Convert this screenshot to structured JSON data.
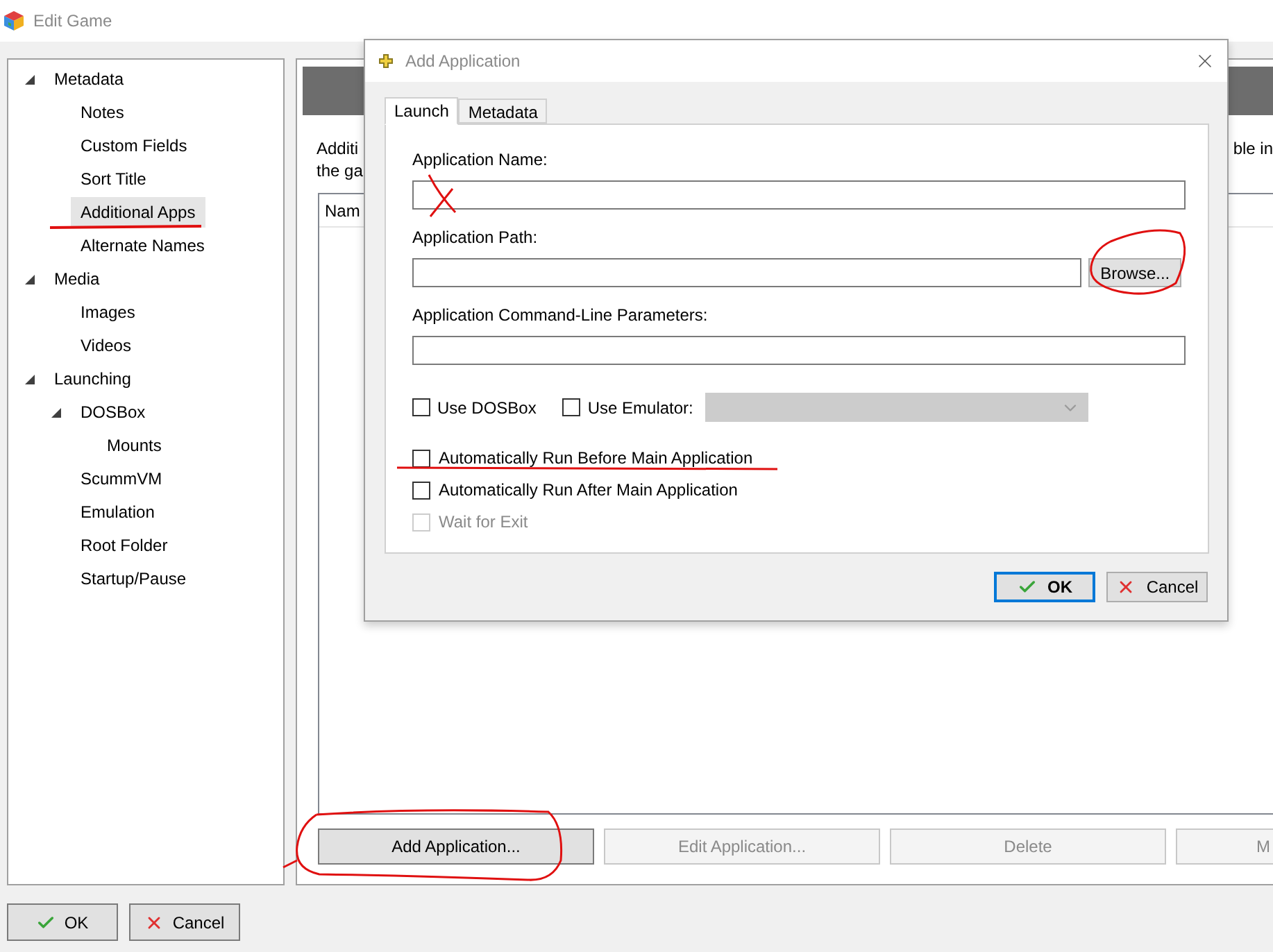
{
  "window": {
    "title": "Edit Game"
  },
  "tree": [
    {
      "label": "Metadata",
      "selected": false,
      "expanded": true,
      "children": [
        {
          "label": "Notes",
          "selected": false
        },
        {
          "label": "Custom Fields",
          "selected": false
        },
        {
          "label": "Sort Title",
          "selected": false
        },
        {
          "label": "Additional Apps",
          "selected": true
        },
        {
          "label": "Alternate Names",
          "selected": false
        }
      ]
    },
    {
      "label": "Media",
      "selected": false,
      "expanded": true,
      "children": [
        {
          "label": "Images",
          "selected": false
        },
        {
          "label": "Videos",
          "selected": false
        }
      ]
    },
    {
      "label": "Launching",
      "selected": false,
      "expanded": true,
      "children": [
        {
          "label": "DOSBox",
          "selected": false,
          "expanded": true,
          "children": [
            {
              "label": "Mounts",
              "selected": false
            }
          ]
        },
        {
          "label": "ScummVM",
          "selected": false
        },
        {
          "label": "Emulation",
          "selected": false
        },
        {
          "label": "Root Folder",
          "selected": false
        },
        {
          "label": "Startup/Pause",
          "selected": false
        }
      ]
    }
  ],
  "description": {
    "left_lines": [
      "Additi",
      "the ga"
    ],
    "right_fragment": "ble in"
  },
  "list": {
    "columns": [
      "Nam"
    ]
  },
  "list_buttons": [
    {
      "label": "Add Application...",
      "disabled": false
    },
    {
      "label": "Edit Application...",
      "disabled": true
    },
    {
      "label": "Delete",
      "disabled": true
    },
    {
      "label": "M",
      "disabled": true
    }
  ],
  "footer_buttons": [
    {
      "label": "OK",
      "kind": "ok"
    },
    {
      "label": "Cancel",
      "kind": "cancel"
    }
  ],
  "dialog": {
    "title": "Add Application",
    "tabs": [
      {
        "label": "Launch",
        "selected": true
      },
      {
        "label": "Metadata",
        "selected": false
      }
    ],
    "name_label": "Application Name:",
    "path_label": "Application Path:",
    "browse": "Browse...",
    "params_label": "Application Command-Line Parameters:",
    "dosbox": {
      "label": "Use DOSBox",
      "checked": false
    },
    "emulator": {
      "label": "Use Emulator:",
      "checked": false,
      "select_disabled": true
    },
    "options": [
      {
        "label": "Automatically Run Before Main Application",
        "checked": false,
        "disabled": false
      },
      {
        "label": "Automatically Run After Main Application",
        "checked": false,
        "disabled": false
      },
      {
        "label": "Wait for Exit",
        "checked": false,
        "disabled": true
      }
    ],
    "buttons": [
      {
        "label": "OK",
        "kind": "ok"
      },
      {
        "label": "Cancel",
        "kind": "cancel"
      }
    ]
  }
}
